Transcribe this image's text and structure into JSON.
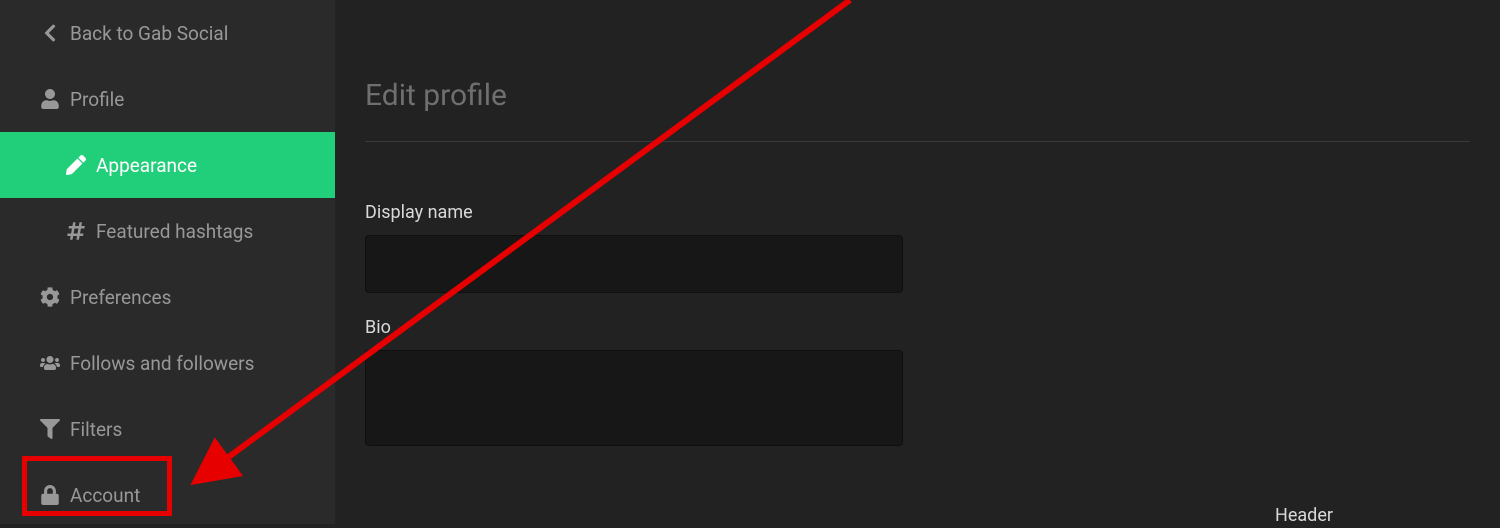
{
  "sidebar": {
    "back_label": "Back to Gab Social",
    "items": [
      {
        "label": "Profile"
      },
      {
        "label": "Appearance"
      },
      {
        "label": "Featured hashtags"
      },
      {
        "label": "Preferences"
      },
      {
        "label": "Follows and followers"
      },
      {
        "label": "Filters"
      },
      {
        "label": "Account"
      }
    ]
  },
  "page": {
    "title": "Edit profile",
    "fields": {
      "display_name_label": "Display name",
      "display_name_value": "",
      "bio_label": "Bio",
      "bio_value": "",
      "header_label": "Header"
    }
  },
  "annotation": {
    "color": "#e60000"
  }
}
